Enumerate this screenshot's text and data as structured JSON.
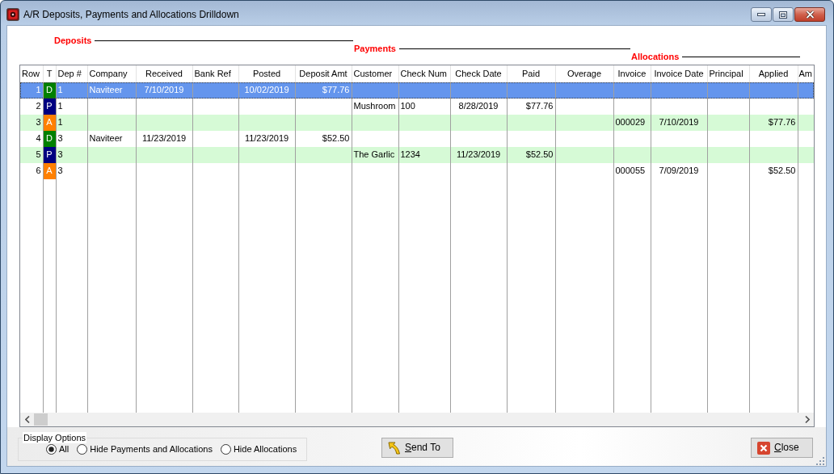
{
  "window": {
    "title": "A/R Deposits, Payments and Allocations Drilldown"
  },
  "sections": [
    {
      "label": "Deposits"
    },
    {
      "label": "Payments"
    },
    {
      "label": "Allocations"
    }
  ],
  "table": {
    "columns": [
      "Row",
      "T",
      "Dep #",
      "Company",
      "Received",
      "Bank Ref",
      "Posted",
      "Deposit Amt",
      "Customer",
      "Check Num",
      "Check Date",
      "Paid",
      "Overage",
      "Invoice",
      "Invoice Date",
      "Principal",
      "Applied",
      "Am"
    ],
    "rows": [
      {
        "selected": true,
        "color": "#008000",
        "row": "1",
        "t": "D",
        "dep_no": "1",
        "company": "Naviteer",
        "received": "7/10/2019",
        "posted": "10/02/2019",
        "deposit_amt": "$77.76"
      },
      {
        "selected": false,
        "color": "#000080",
        "row": "2",
        "t": "P",
        "dep_no": "1",
        "customer": "Mushroom",
        "check_num": "100",
        "check_date": "8/28/2019",
        "paid": "$77.76"
      },
      {
        "selected": false,
        "color": "#ff8000",
        "row": "3",
        "t": "A",
        "dep_no": "1",
        "invoice": "000029",
        "invoice_date": "7/10/2019",
        "applied": "$77.76"
      },
      {
        "selected": false,
        "color": "#008000",
        "row": "4",
        "t": "D",
        "dep_no": "3",
        "company": "Naviteer",
        "received": "11/23/2019",
        "posted": "11/23/2019",
        "deposit_amt": "$52.50"
      },
      {
        "selected": false,
        "color": "#000080",
        "row": "5",
        "t": "P",
        "dep_no": "3",
        "customer": "The Garlic",
        "check_num": "1234",
        "check_date": "11/23/2019",
        "paid": "$52.50"
      },
      {
        "selected": false,
        "color": "#ff8000",
        "row": "6",
        "t": "A",
        "dep_no": "3",
        "invoice": "000055",
        "invoice_date": "7/09/2019",
        "applied": "$52.50"
      }
    ]
  },
  "display_options": {
    "label": "Display Options",
    "options": [
      {
        "label": "All",
        "selected": true
      },
      {
        "label": "Hide Payments and Allocations",
        "selected": false
      },
      {
        "label": "Hide Allocations",
        "selected": false
      }
    ]
  },
  "buttons": [
    {
      "kind": "send",
      "label": "Send To",
      "underline_first": true
    },
    {
      "kind": "close",
      "label": "Close",
      "underline_first": true
    }
  ]
}
